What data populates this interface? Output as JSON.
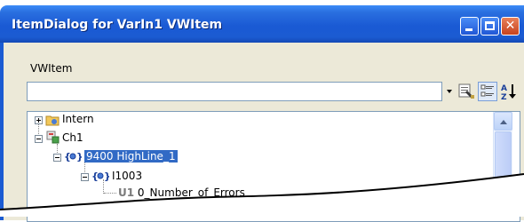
{
  "window": {
    "title": "ItemDialog for VarIn1 VWItem",
    "accent": "#1b5bd2"
  },
  "form": {
    "vwitem_label": "VWItem",
    "combo_value": ""
  },
  "toolbar": {
    "icons": [
      "dropdown-arrow-icon",
      "properties-icon",
      "categorized-view-icon",
      "sort-az-icon"
    ]
  },
  "tree": {
    "items": [
      {
        "label": "Intern",
        "icon": "folder-icon"
      },
      {
        "label": "Ch1",
        "icon": "channel-icon"
      },
      {
        "label": "9400 HighLine_1",
        "icon": "device-icon",
        "selected": true
      },
      {
        "label": "I1003",
        "icon": "device-icon"
      },
      {
        "prefix": "U1",
        "label": "0_Number_of_Errors"
      }
    ]
  }
}
